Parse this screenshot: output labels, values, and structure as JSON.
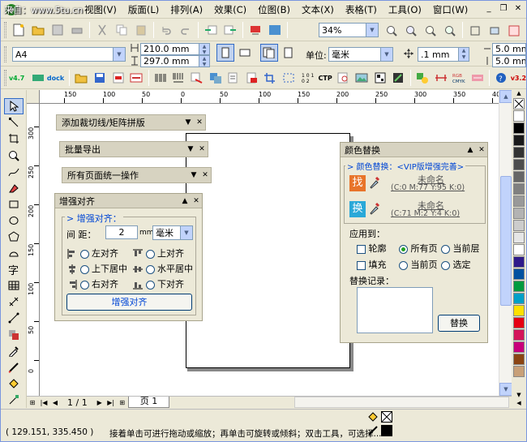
{
  "watermark": "来自：www.5tu.cn",
  "menu": [
    "视图(V)",
    "版面(L)",
    "排列(A)",
    "效果(C)",
    "位图(B)",
    "文本(X)",
    "表格(T)",
    "工具(O)",
    "窗口(W)"
  ],
  "toolbar1": {
    "zoom": "34%"
  },
  "toolbar2": {
    "paper_size": "A4",
    "width": "210.0 mm",
    "height": "297.0 mm",
    "units_label": "单位:",
    "units_value": "毫米",
    "nudge": ".1 mm",
    "dup_x": "5.0 mm",
    "dup_y": "5.0 mm"
  },
  "toolbar3": {
    "version_left": "v4.7",
    "dock_label": "dock",
    "ctp_label": "CTP",
    "version_right": "v3.2"
  },
  "hruler_labels": [
    "150",
    "100",
    "50",
    "0",
    "50",
    "100",
    "150",
    "200",
    "250",
    "300",
    "350",
    "400"
  ],
  "vruler_labels": [
    "300",
    "250",
    "200",
    "150",
    "100",
    "50",
    "0"
  ],
  "dockers": {
    "crop_marks": "添加裁切线/矩阵拼版",
    "batch_export": "批量导出",
    "all_pages": "所有页面统一操作"
  },
  "align_panel": {
    "title": "增强对齐",
    "group_label": "> 增强对齐：",
    "spacing_label": "间 距：",
    "spacing_value": "2",
    "spacing_unit": "mm",
    "unit_select": "毫米",
    "options": [
      {
        "label": "左对齐"
      },
      {
        "label": "上对齐"
      },
      {
        "label": "上下居中"
      },
      {
        "label": "水平居中"
      },
      {
        "label": "右对齐"
      },
      {
        "label": "下对齐"
      }
    ],
    "apply_button": "增强对齐"
  },
  "color_panel": {
    "title": "颜色替换",
    "group_label": "> 颜色替换：<VIP版增强完善>",
    "find_badge": "找",
    "replace_badge": "换",
    "find_name": "未命名",
    "find_value": "(C:0 M:77 Y:95 K:0)",
    "replace_name": "未命名",
    "replace_value": "(C:71 M:2 Y:4 K:0)",
    "find_color": "#e8742a",
    "replace_color": "#2aa8d8",
    "apply_to": "应用到：",
    "opt_outline": "轮廓",
    "opt_all_pages": "所有页",
    "opt_current_layer": "当前层",
    "opt_fill": "填充",
    "opt_current_page": "当前页",
    "opt_selection": "选定",
    "history_label": "替换记录：",
    "replace_button": "替换"
  },
  "bottom": {
    "page_count": "1 / 1",
    "page_tab": "页 1"
  },
  "status": {
    "coords": "( 129.151, 335.450 )",
    "hint": "接着单击可进行拖动或缩放；再单击可旋转或倾斜；双击工具，可选择..."
  },
  "palette_colors": [
    "#ffffff",
    "#000000",
    "#1a1a1a",
    "#333333",
    "#4d4d4d",
    "#666666",
    "#808080",
    "#999999",
    "#b3b3b3",
    "#cccccc",
    "#e6e6e6",
    "#ffffff",
    "#2e1a8a",
    "#0050a0",
    "#009a3e",
    "#00a0c8",
    "#ffe000",
    "#e60012",
    "#d4145a",
    "#c8007a",
    "#8b4513",
    "#c8a078"
  ]
}
